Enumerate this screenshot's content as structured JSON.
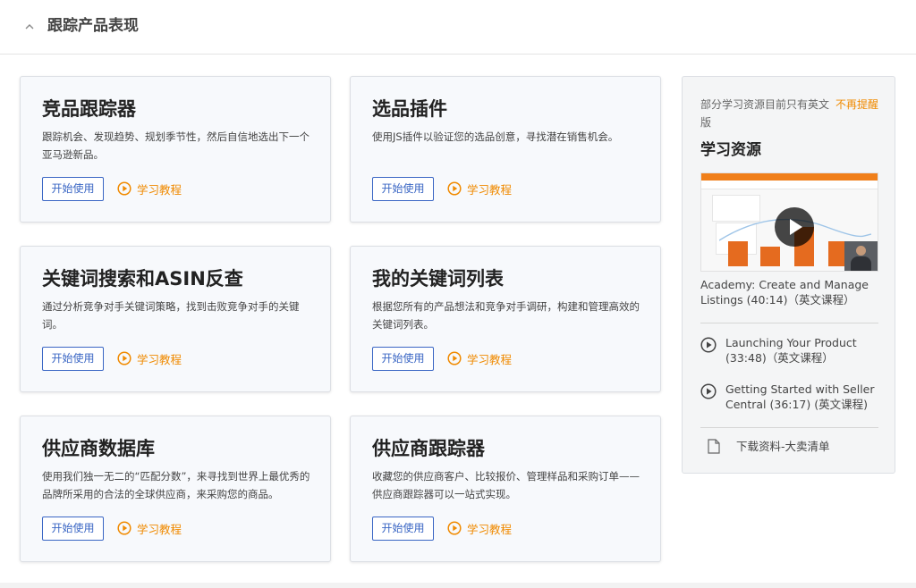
{
  "header": {
    "title": "跟踪产品表现"
  },
  "cards": [
    {
      "title": "竞品跟踪器",
      "desc": "跟踪机会、发现趋势、规划季节性，然后自信地选出下一个亚马逊新品。",
      "start": "开始使用",
      "tutorial": "学习教程"
    },
    {
      "title": "选品插件",
      "desc": "使用JS插件以验证您的选品创意，寻找潜在销售机会。",
      "start": "开始使用",
      "tutorial": "学习教程"
    },
    {
      "title": "关键词搜索和ASIN反查",
      "desc": "通过分析竞争对手关键词策略，找到击败竞争对手的关键词。",
      "start": "开始使用",
      "tutorial": "学习教程"
    },
    {
      "title": "我的关键词列表",
      "desc": "根据您所有的产品想法和竞争对手调研，构建和管理高效的关键词列表。",
      "start": "开始使用",
      "tutorial": "学习教程"
    },
    {
      "title": "供应商数据库",
      "desc": "使用我们独一无二的“匹配分数”，来寻找到世界上最优秀的品牌所采用的合法的全球供应商，来采购您的商品。",
      "start": "开始使用",
      "tutorial": "学习教程"
    },
    {
      "title": "供应商跟踪器",
      "desc": "收藏您的供应商客户、比较报价、管理样品和采购订单——供应商跟踪器可以一站式实现。",
      "start": "开始使用",
      "tutorial": "学习教程"
    }
  ],
  "sidebar": {
    "notice": "部分学习资源目前只有英文版",
    "dismiss": "不再提醒",
    "title": "学习资源",
    "video_caption": "Academy: Create and Manage Listings (40:14)（英文课程）",
    "courses": [
      {
        "label": "Launching Your Product (33:48)（英文课程）"
      },
      {
        "label": "Getting Started with Seller Central (36:17) (英文课程)"
      }
    ],
    "download": "下载资料-大卖清单"
  },
  "colors": {
    "accent_orange": "#f08a00",
    "button_blue": "#3a66c4",
    "card_bg": "#f7f9fc",
    "sidebar_bg": "#f4f5f6"
  }
}
